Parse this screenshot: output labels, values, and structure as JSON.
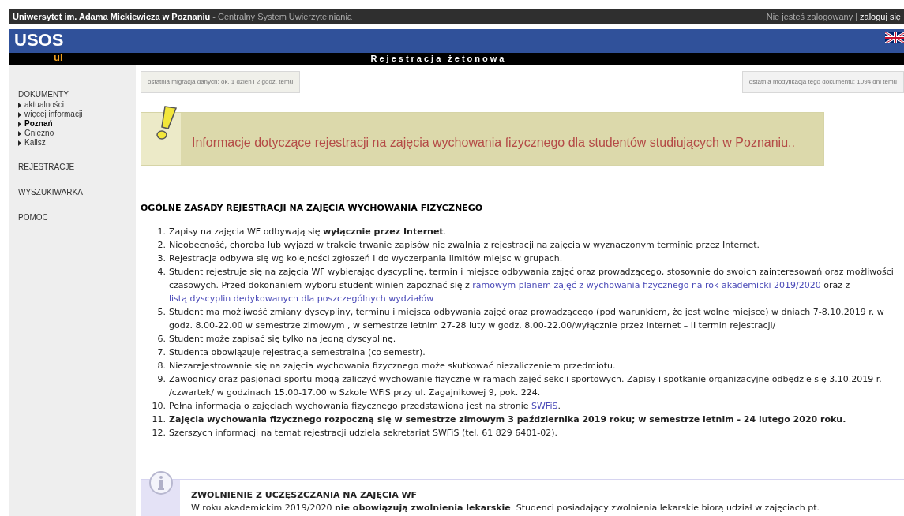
{
  "top_bar": {
    "university": "Uniwersytet im. Adama Mickiewicza w Poznaniu",
    "system": " - Centralny System Uwierzytelniania",
    "login_status": "Nie jesteś zalogowany",
    "separator": "|",
    "login_link": "zaloguj się"
  },
  "header": {
    "logo": "USOS",
    "logo_sub": "ul",
    "title": "Rejestracja żetonowa"
  },
  "sidebar": {
    "sections": [
      {
        "label": "DOKUMENTY",
        "items": [
          {
            "label": "aktualności",
            "selected": false
          },
          {
            "label": "więcej informacji",
            "selected": false
          },
          {
            "label": "Poznań",
            "selected": true
          },
          {
            "label": "Gniezno",
            "selected": false
          },
          {
            "label": "Kalisz",
            "selected": false
          }
        ]
      },
      {
        "label": "REJESTRACJE"
      },
      {
        "label": "WYSZUKIWARKA"
      },
      {
        "label": "POMOC"
      }
    ]
  },
  "meta": {
    "migration": "ostatnia migracja danych: ok. 1 dzień i 2 godz. temu",
    "modified": "ostatnia modyfikacja tego dokumentu: 1094 dni temu"
  },
  "notice": "Informacje dotyczące rejestracji na zajęcia wychowania fizycznego dla studentów studiujących w Poznaniu..",
  "section_heading": "OGÓLNE ZASADY REJESTRACJI NA ZAJĘCIA WYCHOWANIA FIZYCZNEGO",
  "rules": [
    {
      "number": "1.",
      "bold": false,
      "segments": [
        {
          "kind": "text",
          "text": "Zapisy na zajęcia WF odbywają się **wyłącznie przez Internet**."
        }
      ]
    },
    {
      "number": "2.",
      "bold": false,
      "segments": [
        {
          "kind": "text",
          "text": "Nieobecność, choroba lub wyjazd w trakcie trwanie zapisów nie zwalnia z rejestracji na zajęcia w wyznaczonym terminie przez Internet."
        }
      ]
    },
    {
      "number": "3.",
      "bold": false,
      "segments": [
        {
          "kind": "text",
          "text": "Rejestracja odbywa się wg kolejności zgłoszeń i do wyczerpania limitów miejsc w grupach."
        }
      ]
    },
    {
      "number": "4.",
      "bold": false,
      "segments": [
        {
          "kind": "text",
          "text": "Student rejestruje się na zajęcia WF wybierając dyscyplinę, termin i miejsce odbywania zajęć oraz prowadzącego, stosownie do swoich zainteresowań oraz możliwości czasowych. Przed dokonaniem wyboru student winien zapoznać się z "
        },
        {
          "kind": "link",
          "text": "ramowym planem zajęć z wychowania fizycznego na rok akademicki 2019/2020"
        },
        {
          "kind": "text",
          "text": " oraz z "
        },
        {
          "kind": "link",
          "text": "listą dyscyplin dedykowanych dla poszczególnych wydziałów"
        }
      ]
    },
    {
      "number": "5.",
      "bold": false,
      "segments": [
        {
          "kind": "text",
          "text": "Student ma możliwość zmiany dyscypliny, terminu i miejsca odbywania zajęć oraz prowadzącego (pod warunkiem, że jest wolne miejsce) w dniach 7-8.10.2019 r. w godz. 8.00-22.00 w semestrze zimowym , w semestrze letnim 27-28 luty w godz. 8.00-22.00/wyłącznie przez internet – II termin rejestracji/"
        }
      ]
    },
    {
      "number": "6.",
      "bold": false,
      "segments": [
        {
          "kind": "text",
          "text": "Student może zapisać się tylko na jedną dyscyplinę."
        }
      ]
    },
    {
      "number": "7.",
      "bold": false,
      "segments": [
        {
          "kind": "text",
          "text": "Studenta obowiązuje rejestracja semestralna (co semestr)."
        }
      ]
    },
    {
      "number": "8.",
      "bold": false,
      "segments": [
        {
          "kind": "text",
          "text": "Niezarejestrowanie się na zajęcia wychowania fizycznego może skutkować niezaliczeniem przedmiotu."
        }
      ]
    },
    {
      "number": "9.",
      "bold": false,
      "segments": [
        {
          "kind": "text",
          "text": "Zawodnicy oraz pasjonaci sportu mogą zaliczyć wychowanie fizyczne w ramach zajęć sekcji sportowych. Zapisy i spotkanie organizacyjne odbędzie się 3.10.2019 r. /czwartek/ w godzinach 15.00-17.00 w Szkole WFiS przy ul. Zagajnikowej 9, pok. 224."
        }
      ]
    },
    {
      "number": "10.",
      "bold": false,
      "segments": [
        {
          "kind": "text",
          "text": "Pełna informacja o zajęciach wychowania fizycznego przedstawiona jest na stronie "
        },
        {
          "kind": "link",
          "text": "SWFiS"
        },
        {
          "kind": "text",
          "text": "."
        }
      ]
    },
    {
      "number": "11.",
      "bold": true,
      "segments": [
        {
          "kind": "text",
          "text": "Zajęcia wychowania fizycznego rozpoczną się w semestrze zimowym 3 października 2019 roku; w semestrze letnim - 24 lutego 2020 roku."
        }
      ]
    },
    {
      "number": "12.",
      "bold": false,
      "segments": [
        {
          "kind": "text",
          "text": "Szerszych informacji na temat rejestracji udziela sekretariat SWFiS (tel. 61 829 6401-02)."
        }
      ]
    }
  ],
  "info_box": {
    "title": "ZWOLNIENIE Z UCZĘSZCZANIA NA ZAJĘCIA WF",
    "text": "W roku akademickim 2019/2020 **nie obowiązują zwolnienia lekarskie**. Studenci posiadający zwolnienia lekarskie biorą udział w zajęciach pt."
  }
}
